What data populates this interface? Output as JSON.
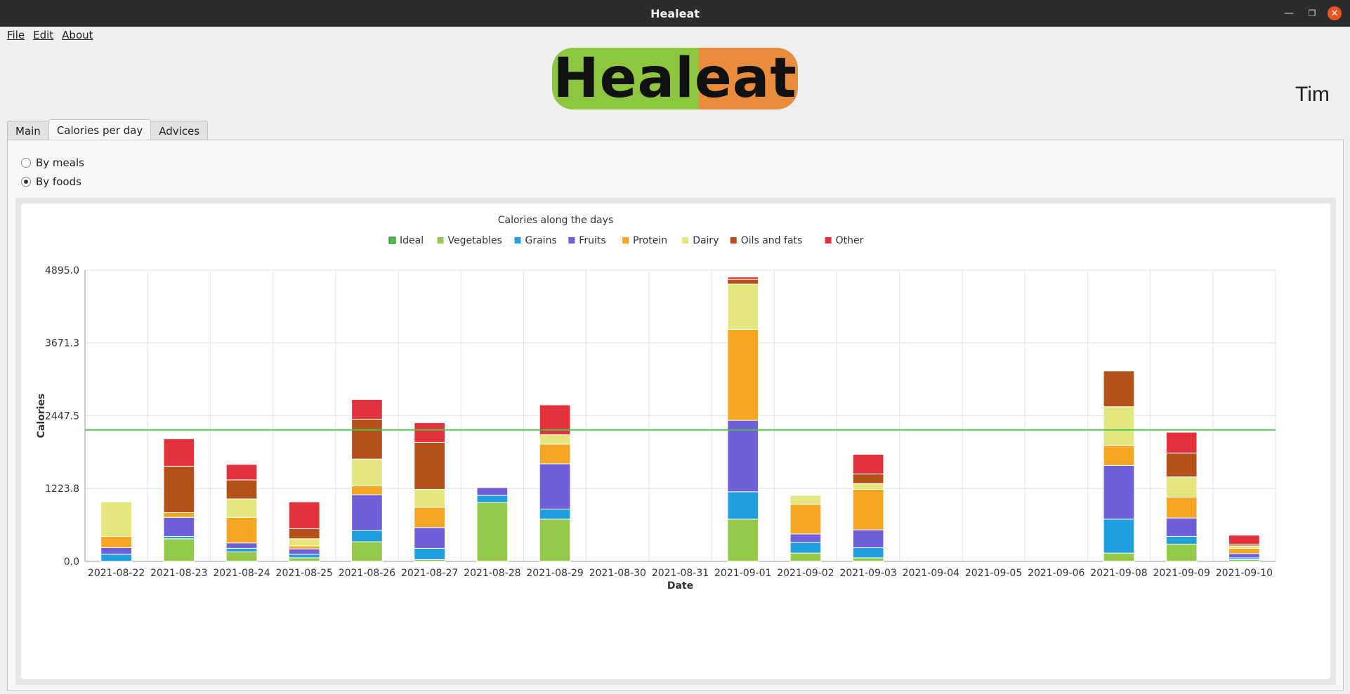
{
  "window": {
    "title": "Healeat"
  },
  "menu": {
    "items": [
      {
        "label": "File"
      },
      {
        "label": "Edit"
      },
      {
        "label": "About"
      }
    ]
  },
  "logo_text": "Healeat",
  "user": {
    "name": "Tim"
  },
  "tabs": [
    {
      "label": "Main",
      "active": false
    },
    {
      "label": "Calories per day",
      "active": true
    },
    {
      "label": "Advices",
      "active": false
    }
  ],
  "view_mode": {
    "options": [
      {
        "label": "By meals",
        "checked": false
      },
      {
        "label": "By foods",
        "checked": true
      }
    ]
  },
  "icons": {
    "minimize": "minimize-icon",
    "maximize": "maximize-icon",
    "close": "close-icon"
  },
  "colors": {
    "Ideal": "#4cc24c",
    "Vegetables": "#94c94a",
    "Grains": "#209fdf",
    "Fruits": "#6f5fd8",
    "Protein": "#f5a623",
    "Dairy": "#e3e77f",
    "Oils and fats": "#b5501b",
    "Other": "#e3323b",
    "close_button": "#e95420"
  },
  "chart_data": {
    "type": "bar",
    "stacked": true,
    "title": "Calories along the days",
    "xlabel": "Date",
    "ylabel": "Calories",
    "ylim": [
      0,
      4895.0
    ],
    "yticks": [
      "0.0",
      "1223.8",
      "2447.5",
      "3671.3",
      "4895.0"
    ],
    "legend_position": "top",
    "legend": [
      "Ideal",
      "Vegetables",
      "Grains",
      "Fruits",
      "Protein",
      "Dairy",
      "Oils and fats",
      "Other"
    ],
    "ideal_line": {
      "name": "Ideal",
      "value": 2210
    },
    "categories": [
      "2021-08-22",
      "2021-08-23",
      "2021-08-24",
      "2021-08-25",
      "2021-08-26",
      "2021-08-27",
      "2021-08-28",
      "2021-08-29",
      "2021-08-30",
      "2021-08-31",
      "2021-09-01",
      "2021-09-02",
      "2021-09-03",
      "2021-09-04",
      "2021-09-05",
      "2021-09-06",
      "2021-09-08",
      "2021-09-09",
      "2021-09-10"
    ],
    "series": [
      {
        "name": "Vegetables",
        "values": [
          0,
          380,
          160,
          60,
          330,
          30,
          990,
          710,
          0,
          0,
          710,
          140,
          60,
          0,
          0,
          0,
          140,
          290,
          30
        ]
      },
      {
        "name": "Grains",
        "values": [
          120,
          40,
          60,
          60,
          190,
          190,
          120,
          170,
          0,
          0,
          460,
          180,
          170,
          0,
          0,
          0,
          570,
          130,
          30
        ]
      },
      {
        "name": "Fruits",
        "values": [
          110,
          320,
          90,
          90,
          600,
          350,
          130,
          760,
          0,
          0,
          1200,
          140,
          300,
          0,
          0,
          0,
          900,
          310,
          70
        ]
      },
      {
        "name": "Protein",
        "values": [
          190,
          80,
          430,
          50,
          150,
          340,
          0,
          330,
          0,
          0,
          1530,
          500,
          680,
          0,
          0,
          0,
          340,
          350,
          90
        ]
      },
      {
        "name": "Dairy",
        "values": [
          580,
          0,
          310,
          120,
          450,
          300,
          0,
          160,
          0,
          0,
          760,
          150,
          100,
          0,
          0,
          0,
          650,
          340,
          40
        ]
      },
      {
        "name": "Oils and fats",
        "values": [
          0,
          780,
          320,
          170,
          670,
          790,
          0,
          0,
          0,
          0,
          80,
          0,
          160,
          0,
          0,
          0,
          600,
          400,
          30
        ]
      },
      {
        "name": "Other",
        "values": [
          0,
          460,
          260,
          450,
          330,
          330,
          0,
          500,
          0,
          0,
          40,
          0,
          330,
          0,
          0,
          0,
          0,
          350,
          150
        ]
      }
    ]
  }
}
